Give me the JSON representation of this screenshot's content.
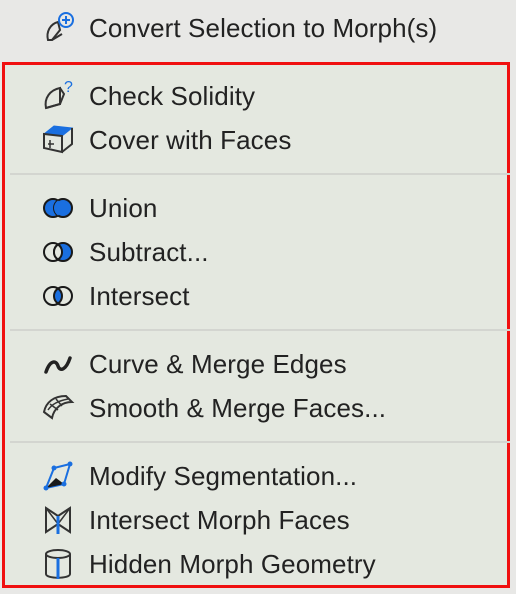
{
  "menu": {
    "items": [
      {
        "label": "Convert Selection to Morph(s)",
        "icon": "convert-morph-icon"
      },
      {
        "label": "Check Solidity",
        "icon": "check-solidity-icon"
      },
      {
        "label": "Cover with Faces",
        "icon": "cover-faces-icon"
      },
      {
        "label": "Union",
        "icon": "union-icon"
      },
      {
        "label": "Subtract...",
        "icon": "subtract-icon"
      },
      {
        "label": "Intersect",
        "icon": "intersect-icon"
      },
      {
        "label": "Curve & Merge Edges",
        "icon": "curve-merge-edges-icon"
      },
      {
        "label": "Smooth & Merge Faces...",
        "icon": "smooth-merge-faces-icon"
      },
      {
        "label": "Modify Segmentation...",
        "icon": "modify-segmentation-icon"
      },
      {
        "label": "Intersect Morph Faces",
        "icon": "intersect-morph-faces-icon"
      },
      {
        "label": "Hidden Morph Geometry",
        "icon": "hidden-morph-geometry-icon"
      }
    ]
  },
  "colors": {
    "highlight_frame": "#f01010",
    "icon_blue": "#1a6fe0",
    "text": "#222222"
  }
}
